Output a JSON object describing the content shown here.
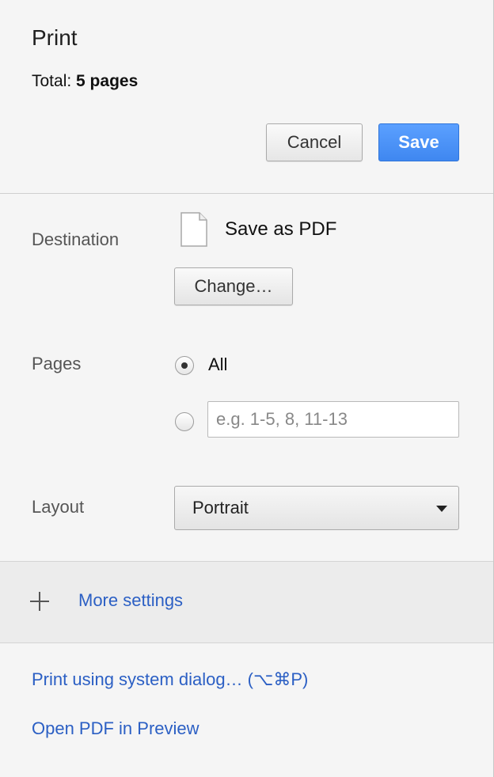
{
  "header": {
    "title": "Print",
    "total_label": "Total:",
    "total_value": "5 pages",
    "cancel_label": "Cancel",
    "save_label": "Save"
  },
  "destination": {
    "label": "Destination",
    "icon": "file-icon",
    "name": "Save as PDF",
    "change_label": "Change…"
  },
  "pages": {
    "label": "Pages",
    "all_label": "All",
    "all_selected": true,
    "custom_value": "",
    "custom_placeholder": "e.g. 1-5, 8, 11-13"
  },
  "layout": {
    "label": "Layout",
    "selected": "Portrait"
  },
  "more_settings": {
    "icon": "plus-icon",
    "label": "More settings"
  },
  "links": {
    "system_dialog": "Print using system dialog… (⌥⌘P)",
    "open_preview": "Open PDF in Preview"
  },
  "colors": {
    "background": "#f5f5f5",
    "save_button": "#4a90f5",
    "link": "#2b5fc4"
  }
}
